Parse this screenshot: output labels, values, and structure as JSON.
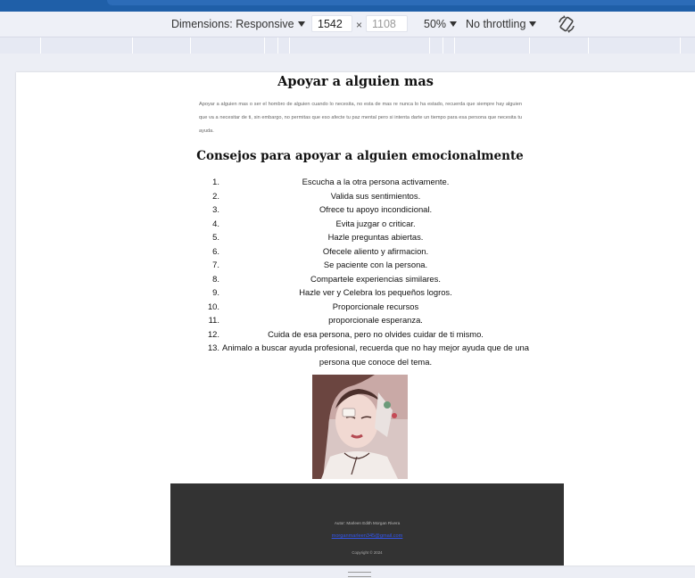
{
  "toolbar": {
    "dimensions_label": "Dimensions: Responsive",
    "width_value": "1542",
    "height_placeholder": "1108",
    "times": "×",
    "zoom_label": "50%",
    "throttling_label": "No throttling",
    "rotate_icon": "rotate-icon"
  },
  "page": {
    "title": "Apoyar a alguien mas",
    "intro": "Apoyar a alguien mas o ser el hombro de alguien cuando lo necesita, no esta de mas re nunca lo ha estado, recuerda que siempre hay alguien que va a necesitar de ti, sin embargo, no permitas que eso afecte tu paz mental pero si intenta darte un tiempo para esa persona que necesita tu ayuda.",
    "section_title": "Consejos para apoyar a alguien emocionalmente",
    "tips": [
      {
        "n": "1.",
        "text": "Escucha a la otra persona activamente."
      },
      {
        "n": "2.",
        "text": "Valida sus sentimientos."
      },
      {
        "n": "3.",
        "text": "Ofrece tu apoyo incondicional."
      },
      {
        "n": "4.",
        "text": "Evita juzgar o criticar."
      },
      {
        "n": "5.",
        "text": "Hazle preguntas abiertas."
      },
      {
        "n": "6.",
        "text": "Ofecele aliento y afirmacion."
      },
      {
        "n": "7.",
        "text": "Se paciente con la persona."
      },
      {
        "n": "8.",
        "text": "Compartele experiencias similares."
      },
      {
        "n": "9.",
        "text": "Hazle ver y Celebra los pequeños logros."
      },
      {
        "n": "10.",
        "text": "Proporcionale recursos"
      },
      {
        "n": "11.",
        "text": "proporcionale esperanza."
      },
      {
        "n": "12.",
        "text": "Cuida de esa persona, pero no olvides cuidar de ti mismo."
      },
      {
        "n": "13.",
        "text": "Animalo a buscar ayuda profesional, recuerda que no hay mejor ayuda que de una persona que conoce del tema."
      }
    ],
    "footer": {
      "author": "Autor: Marleen Edith Morgan Rivera",
      "email": "morganmarleen345@gmail.com",
      "copyright": "Copyright © 2024"
    }
  },
  "colors": {
    "footer_bg": "#333333",
    "link": "#3355ee",
    "toolbar_bg": "#eef0f7"
  }
}
